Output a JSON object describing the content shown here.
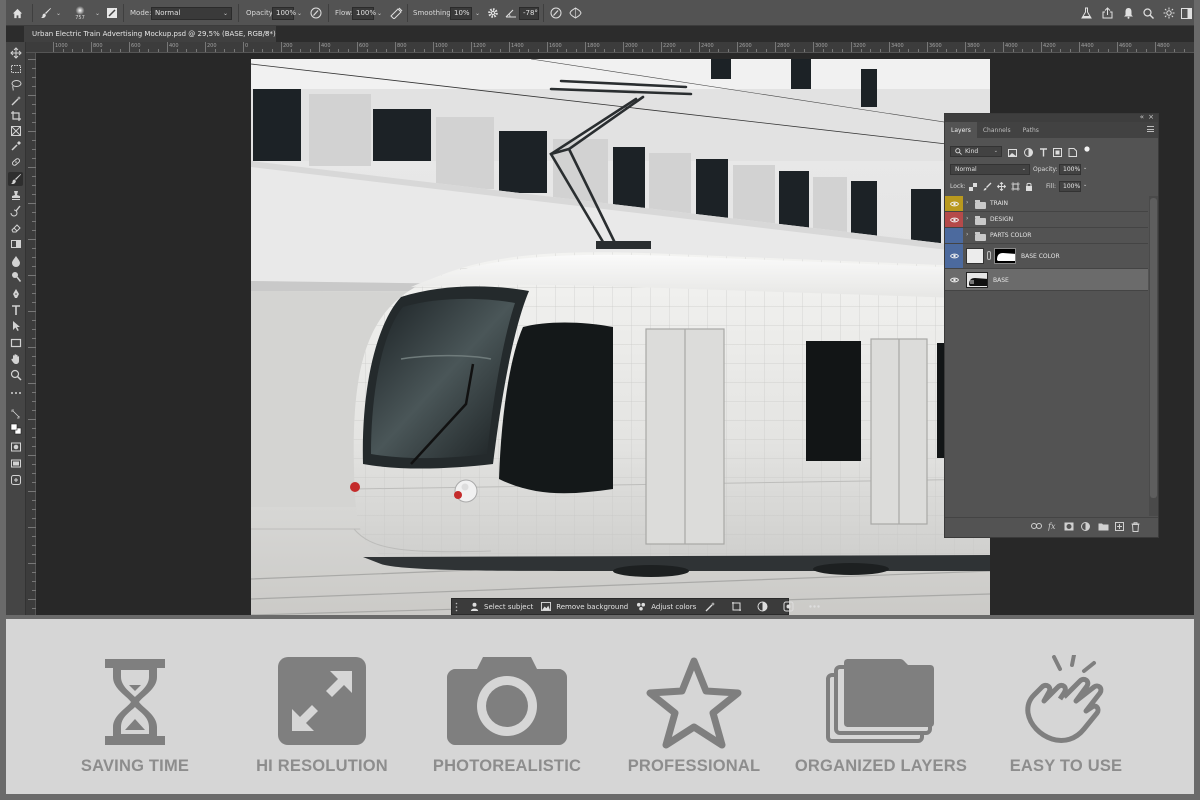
{
  "options_bar": {
    "brush_size": "757",
    "mode_label": "Mode:",
    "mode_value": "Normal",
    "opacity_label": "Opacity:",
    "opacity_value": "100%",
    "flow_label": "Flow:",
    "flow_value": "100%",
    "smoothing_label": "Smoothing:",
    "smoothing_value": "10%",
    "angle_value": "-78°"
  },
  "document_tab": {
    "title": "Urban Electric Train Advertising Mockup.psd @ 29,5% (BASE, RGB/8*)",
    "close": "×"
  },
  "ruler_top_ticks": [
    "1000",
    "800",
    "600",
    "400",
    "200",
    "0",
    "200",
    "400",
    "600",
    "800",
    "1000",
    "1200",
    "1400",
    "1600",
    "1800",
    "2000",
    "2200",
    "2400",
    "2600",
    "2800",
    "3000",
    "3200",
    "3400",
    "3600",
    "3800",
    "4000",
    "4200",
    "4400",
    "4600",
    "4800",
    "5000"
  ],
  "context_taskbar": {
    "select_subject": "Select subject",
    "remove_background": "Remove background",
    "adjust_colors": "Adjust colors"
  },
  "layers_panel": {
    "tabs": [
      "Layers",
      "Channels",
      "Paths"
    ],
    "filter_kind": "Kind",
    "blend_mode": "Normal",
    "opacity_label": "Opacity:",
    "opacity_value": "100%",
    "lock_label": "Lock:",
    "fill_label": "Fill:",
    "fill_value": "100%",
    "layers": [
      {
        "name": "TRAIN",
        "type": "group",
        "color": "#b9991e"
      },
      {
        "name": "DESIGN",
        "type": "group",
        "color": "#b54a4a"
      },
      {
        "name": "PARTS COLOR",
        "type": "group",
        "color": "#4c6a9e"
      },
      {
        "name": "BASE COLOR",
        "type": "fill",
        "color": "#4c6a9e"
      },
      {
        "name": "BASE",
        "type": "smart-object",
        "color": ""
      }
    ]
  },
  "features": [
    {
      "label": "SAVING TIME",
      "icon": "hourglass-icon"
    },
    {
      "label": "HI RESOLUTION",
      "icon": "expand-arrows-icon"
    },
    {
      "label": "PHOTOREALISTIC",
      "icon": "camera-icon"
    },
    {
      "label": "PROFESSIONAL",
      "icon": "star-icon"
    },
    {
      "label": "ORGANIZED LAYERS",
      "icon": "stacked-layers-icon"
    },
    {
      "label": "EASY TO USE",
      "icon": "hand-tap-icon"
    }
  ],
  "colors": {
    "feature_icon": "#7f7f7f",
    "feature_label": "#8d8d8d",
    "panel_bg": "#535353",
    "canvas_bg": "#282828"
  }
}
